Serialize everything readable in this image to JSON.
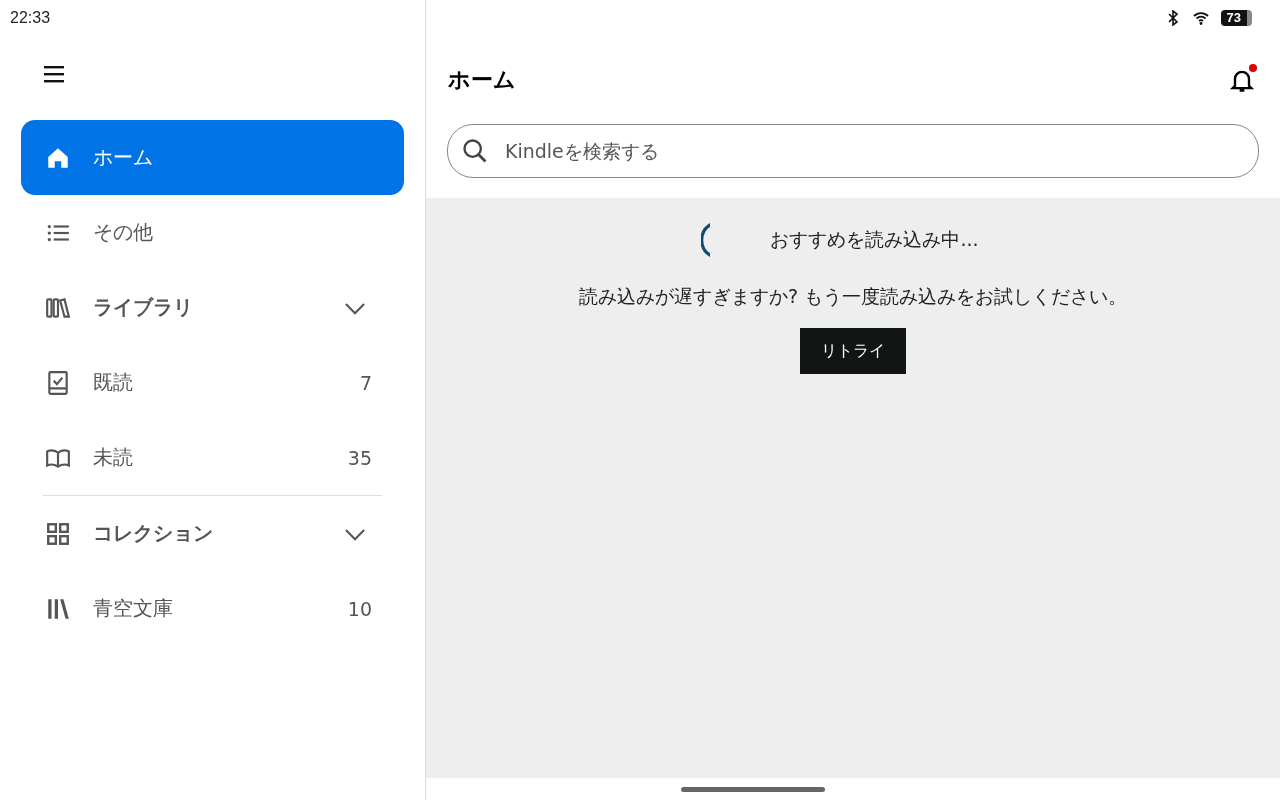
{
  "status_bar": {
    "time": "22:33",
    "battery": "73"
  },
  "sidebar": {
    "items": [
      {
        "kind": "link",
        "label": "ホーム",
        "selected": true
      },
      {
        "kind": "link",
        "label": "その他",
        "selected": false
      },
      {
        "kind": "section",
        "label": "ライブラリ",
        "selected": false
      },
      {
        "kind": "link",
        "label": "既読",
        "count": "7",
        "selected": false
      },
      {
        "kind": "link",
        "label": "未読",
        "count": "35",
        "selected": false
      },
      {
        "kind": "section",
        "label": "コレクション",
        "selected": false
      },
      {
        "kind": "link",
        "label": "青空文庫",
        "count": "10",
        "selected": false
      }
    ]
  },
  "header": {
    "title": "ホーム",
    "notification_unread": true
  },
  "search": {
    "placeholder": "Kindleを検索する"
  },
  "content": {
    "loading_text": "おすすめを読み込み中...",
    "message": "読み込みが遅すぎますか? もう一度読み込みをお試しください。",
    "retry_button": "リトライ"
  }
}
